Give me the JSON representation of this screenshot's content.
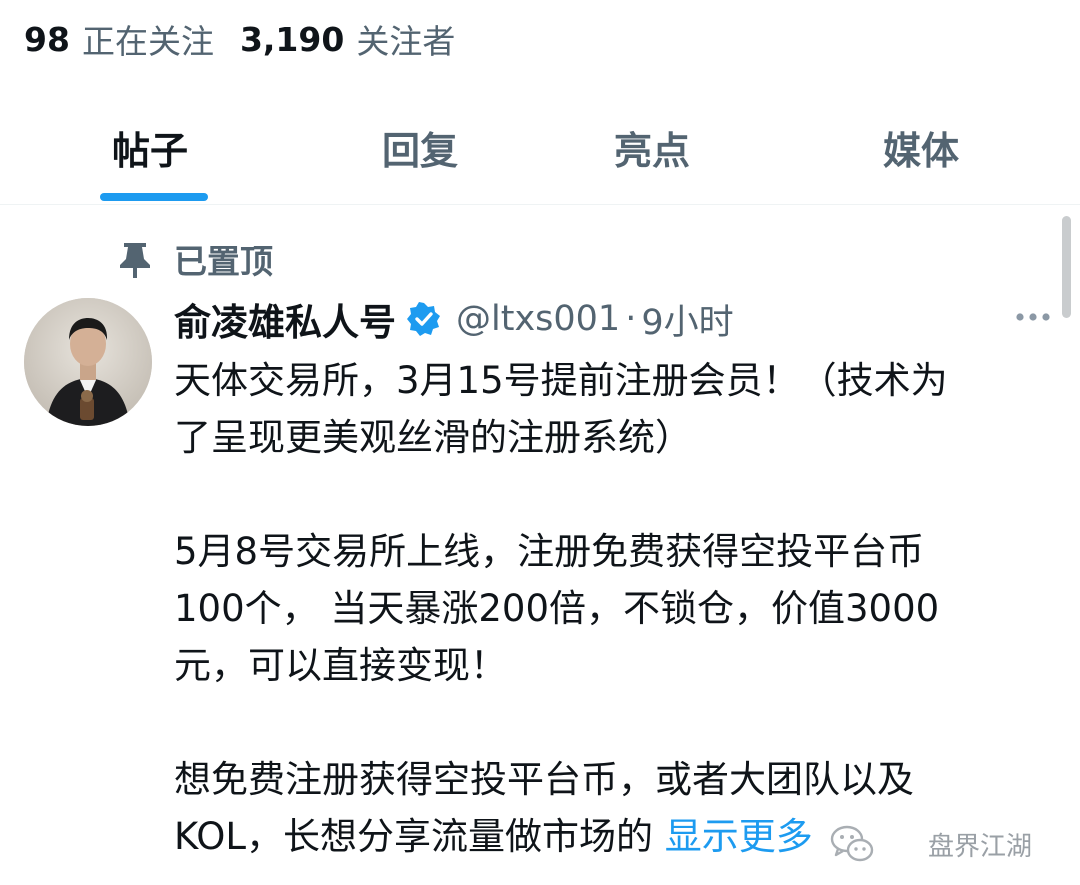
{
  "profile_stats": {
    "following_count": "98",
    "following_label": "正在关注",
    "followers_count": "3,190",
    "followers_label": "关注者"
  },
  "tabs": [
    {
      "label": "帖子",
      "active": true
    },
    {
      "label": "回复",
      "active": false
    },
    {
      "label": "亮点",
      "active": false
    },
    {
      "label": "媒体",
      "active": false
    }
  ],
  "post": {
    "pinned_label": "已置顶",
    "author_name": "俞凌雄私人号",
    "handle": "@ltxs001",
    "separator": "·",
    "time": "9小时",
    "body": {
      "p1": [
        "天体交易所，3月15号提前注册会员！（技术为",
        "了呈现更美观丝滑的注册系统）"
      ],
      "p2": [
        "5月8号交易所上线，注册免费获得空投平台币",
        "100个， 当天暴涨200倍，不锁仓，价值3000",
        "元，可以直接变现！"
      ],
      "p3_line1": "想免费注册获得空投平台币，或者大团队以及",
      "p3_line2": "KOL，长想分享流量做市场的 "
    },
    "show_more": "显示更多"
  },
  "watermark": {
    "text": "盘界江湖",
    "icon": "wechat-icon"
  },
  "colors": {
    "accent": "#1d9bf0",
    "secondary_text": "#536471",
    "primary_text": "#0f1419"
  }
}
